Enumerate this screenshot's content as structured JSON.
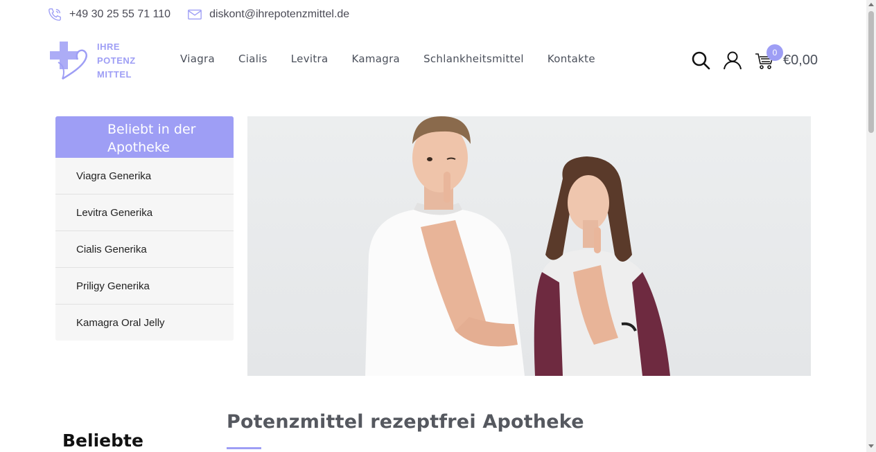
{
  "topbar": {
    "phone": "+49 30 25 55 71 110",
    "email": "diskont@ihrepotenzmittel.de",
    "phone_icon": "phone-icon",
    "email_icon": "envelope-icon"
  },
  "logo": {
    "line1": "IHRE",
    "line2": "POTENZ",
    "line3": "MITTEL",
    "color": "#9e9ef5"
  },
  "nav": {
    "items": [
      {
        "label": "Viagra"
      },
      {
        "label": "Cialis"
      },
      {
        "label": "Levitra"
      },
      {
        "label": "Kamagra"
      },
      {
        "label": "Schlankheitsmittel"
      },
      {
        "label": "Kontakte"
      }
    ]
  },
  "header": {
    "search_icon": "search-icon",
    "user_icon": "user-icon",
    "cart_icon": "cart-icon",
    "cart_count": "0",
    "cart_total": "€0,00"
  },
  "sidebar": {
    "heading": "Beliebt in der Apotheke",
    "items": [
      {
        "label": "Viagra Generika"
      },
      {
        "label": "Levitra Generika"
      },
      {
        "label": "Cialis Generika"
      },
      {
        "label": "Priligy Generika"
      },
      {
        "label": "Kamagra Oral Jelly"
      }
    ]
  },
  "main": {
    "title": "Potenzmittel rezeptfrei Apotheke",
    "side_heading": "Beliebte"
  },
  "colors": {
    "accent": "#9e9ef5",
    "nav_text": "#4a4f5a",
    "sidebar_bg": "#f6f6f6"
  }
}
